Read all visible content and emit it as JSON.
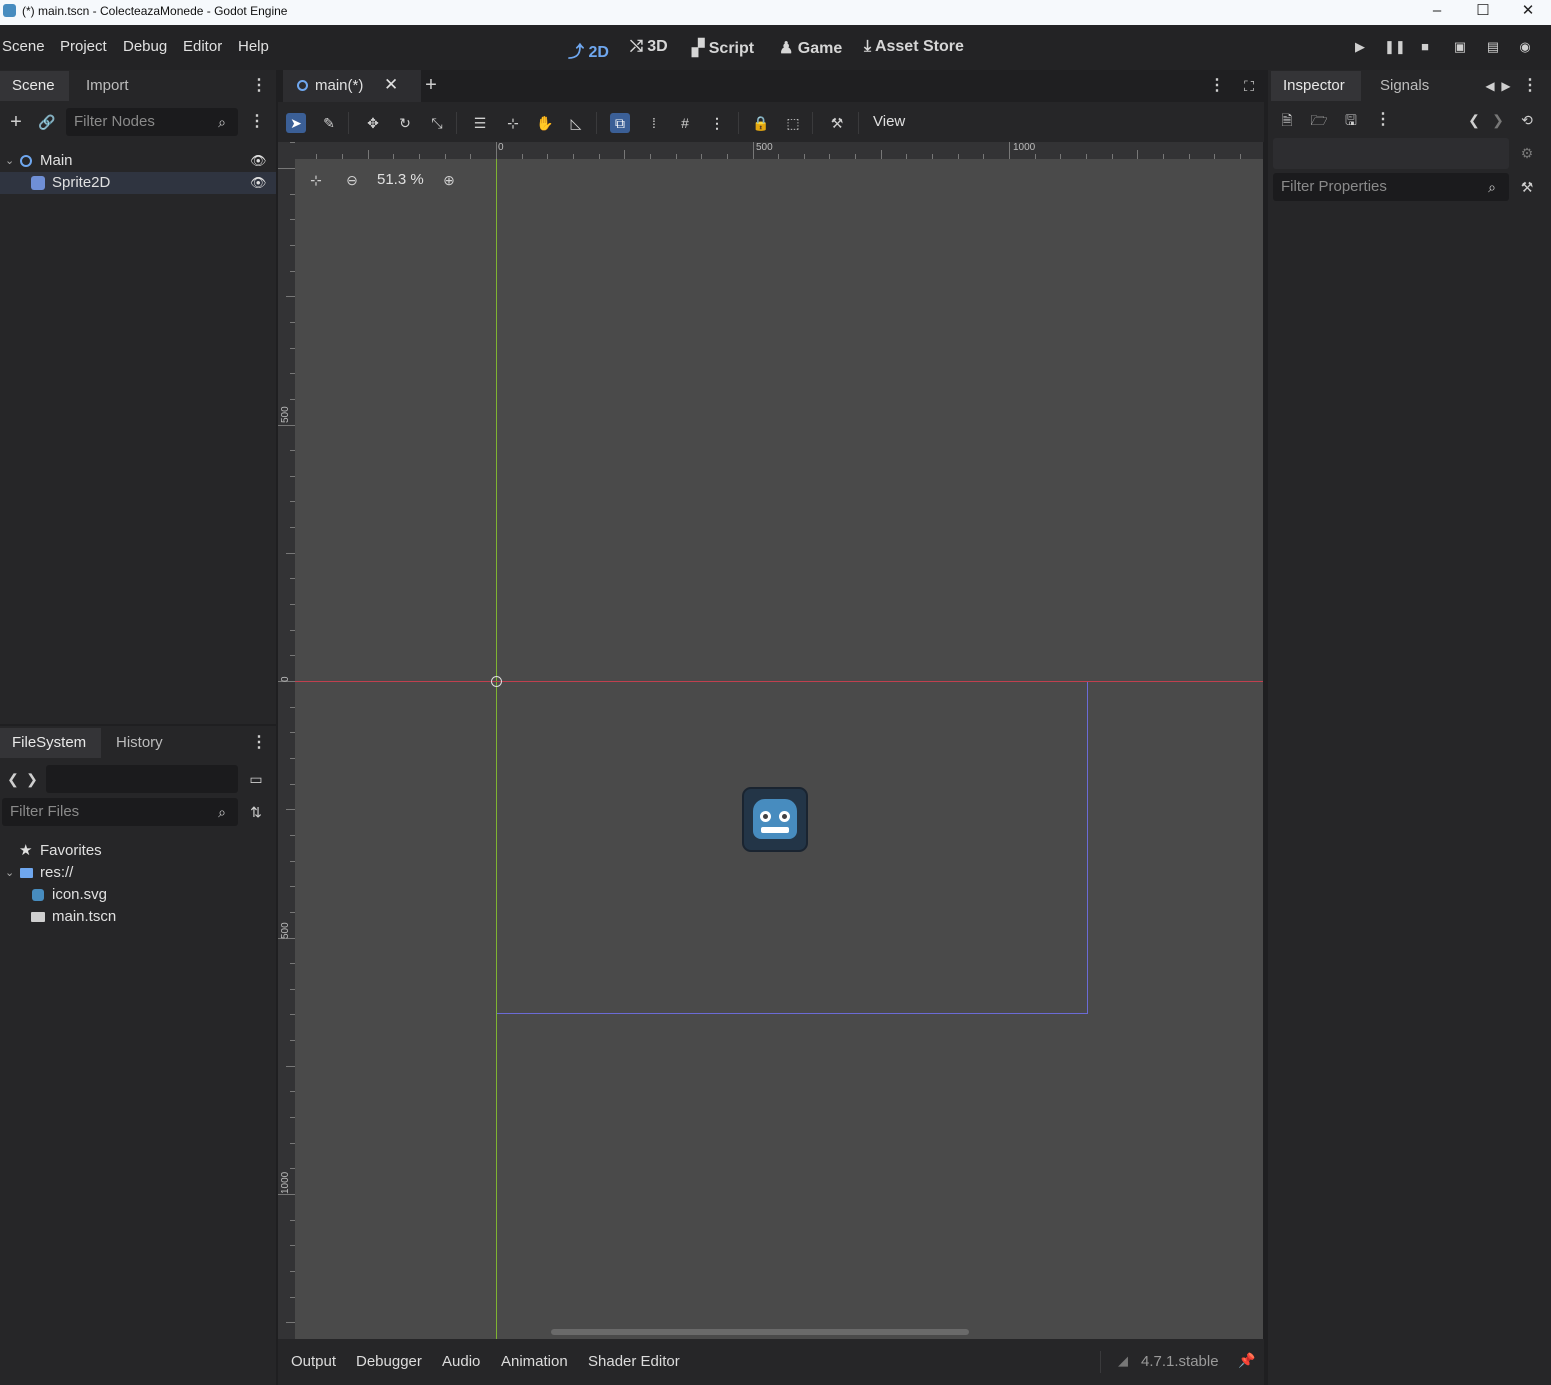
{
  "window": {
    "title": "(*) main.tscn - ColecteazaMonede - Godot Engine",
    "controls": [
      "–",
      "☐",
      "✕"
    ]
  },
  "menu": {
    "items": [
      "Scene",
      "Project",
      "Debug",
      "Editor",
      "Help"
    ]
  },
  "workspaces": [
    {
      "label": "2D",
      "icon": "2d-icon",
      "active": true
    },
    {
      "label": "3D",
      "icon": "3d-icon",
      "active": false
    },
    {
      "label": "Script",
      "icon": "script-icon",
      "active": false
    },
    {
      "label": "Game",
      "icon": "game-icon",
      "active": false
    },
    {
      "label": "Asset Store",
      "icon": "download-icon",
      "active": false
    }
  ],
  "scene_dock": {
    "tabs": [
      "Scene",
      "Import"
    ],
    "filter_placeholder": "Filter Nodes",
    "nodes": [
      {
        "name": "Main",
        "icon": "node2d-icon",
        "expanded": true
      },
      {
        "name": "Sprite2D",
        "icon": "sprite2d-icon"
      }
    ]
  },
  "filesystem_dock": {
    "tabs": [
      "FileSystem",
      "History"
    ],
    "path_value": "",
    "filter_placeholder": "Filter Files",
    "items": [
      {
        "label": "Favorites",
        "icon": "star-icon"
      },
      {
        "label": "res://",
        "icon": "folder-icon"
      },
      {
        "label": "icon.svg",
        "icon": "godot-icon"
      },
      {
        "label": "main.tscn",
        "icon": "scene-icon"
      }
    ]
  },
  "editor": {
    "scene_tab": "main(*)",
    "zoom": "51.3 %",
    "view_menu": "View",
    "ruler_h": [
      "0",
      "500",
      "1000"
    ],
    "ruler_v": [
      "500",
      "0",
      "500",
      "1000"
    ]
  },
  "bottom_panel": {
    "tabs": [
      "Output",
      "Debugger",
      "Audio",
      "Animation",
      "Shader Editor"
    ],
    "version": "4.7.1.stable"
  },
  "inspector": {
    "tabs": [
      "Inspector",
      "Signals"
    ],
    "filter_placeholder": "Filter Properties"
  },
  "colors": {
    "accent": "#6fa7ef",
    "x_axis": "#c0404f",
    "y_axis": "#7fb432",
    "viewport_bg": "#4a4a4a",
    "screen_rect": "#6b6bd6"
  }
}
